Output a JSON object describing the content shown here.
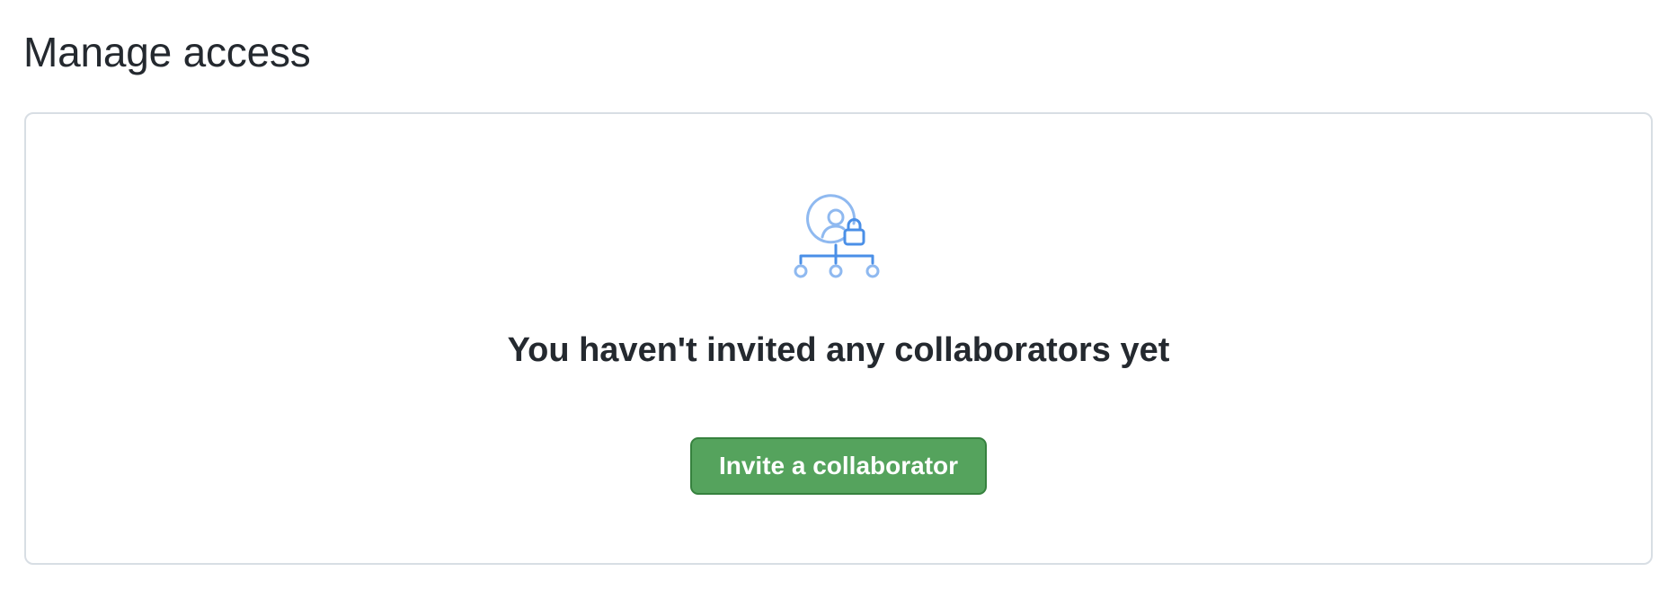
{
  "page": {
    "title": "Manage access"
  },
  "blankslate": {
    "icon": "person-lock-tree-icon",
    "heading": "You haven't invited any collaborators yet",
    "button_label": "Invite a collaborator"
  },
  "colors": {
    "text": "#24292f",
    "border": "#d8dee4",
    "button_bg": "#55a35d",
    "button_border": "#36813e",
    "icon_blue": "#4a8fe7",
    "icon_light_blue": "#8fb9f0"
  }
}
